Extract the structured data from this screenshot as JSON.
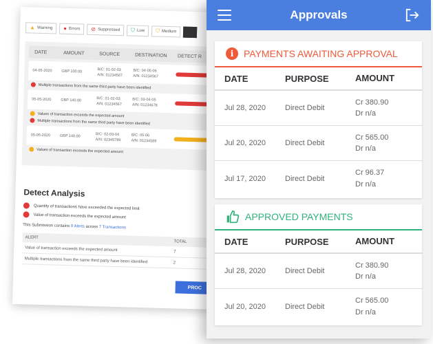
{
  "back": {
    "legend": [
      {
        "label": "Warning",
        "icon": "warning-icon",
        "color": "#f2b01e"
      },
      {
        "label": "Errors",
        "icon": "error-icon",
        "color": "#e03a3a"
      },
      {
        "label": "Suppressed",
        "icon": "suppressed-icon",
        "color": "#e03a3a"
      },
      {
        "label": "Low",
        "icon": "shield-low-icon",
        "color": "#2fb37a"
      },
      {
        "label": "Medium",
        "icon": "shield-medium-icon",
        "color": "#f2b01e"
      }
    ],
    "columns": [
      "DATE",
      "AMOUNT",
      "SOURCE",
      "DESTINATION",
      "DETECT R"
    ],
    "rows": [
      {
        "date": "04-05-2020",
        "amount": "GBP 100.00",
        "source": [
          "B/C: 01-02-03",
          "A/N: 01234567"
        ],
        "destination": [
          "B/C: 04-05-06",
          "A/N: 01234567"
        ],
        "bar": "#e03a3a",
        "notes": [
          "Multiple transactions from the same third party have been identified"
        ]
      },
      {
        "date": "05-05-2020",
        "amount": "GBP 140.00",
        "source": [
          "B/C: 01-02-03",
          "A/N: 01234567"
        ],
        "destination": [
          "B/C: 03-04-05",
          "A/N: 01234678"
        ],
        "bar": "#e03a3a",
        "notes": [
          "Values of transaction exceeds the expected amount",
          "Multiple transactions from the same third party have been identified"
        ]
      },
      {
        "date": "05-05-2020",
        "amount": "GBP 140.00",
        "source": [
          "B/C: 02-03-04",
          "A/N: 02345789"
        ],
        "destination": [
          "B/C: 05-06",
          "A/N: 01234589"
        ],
        "bar": "#f2b01e",
        "notes": [
          "Values of transaction exceeds the expected amount"
        ]
      }
    ],
    "analysis": {
      "title": "Detect Analysis",
      "items": [
        "Quantity of transactions have exceeded the expected limit",
        "Value of transaction exceeds the expected amount"
      ],
      "summary_prefix": "This Submission contains ",
      "summary_alerts": "9 Alerts",
      "summary_mid": " across ",
      "summary_tx": "7 Transactions",
      "table_head": [
        "ALERT",
        "TOTAL"
      ],
      "table_rows": [
        {
          "alert": "Value of transaction exceeds the expected amount",
          "total": "7"
        },
        {
          "alert": "Multiple transactions from the same third party have been identified",
          "total": "2"
        }
      ],
      "button": "PROC"
    }
  },
  "mobile": {
    "title": "Approvals",
    "awaiting": {
      "title": "PAYMENTS AWAITING APPROVAL",
      "columns": {
        "date": "DATE",
        "purpose": "PURPOSE",
        "amount": "AMOUNT"
      },
      "rows": [
        {
          "date": "Jul 28, 2020",
          "purpose": "Direct Debit",
          "cr": "Cr 380.90",
          "dr": "Dr n/a"
        },
        {
          "date": "Jul 20, 2020",
          "purpose": "Direct Debit",
          "cr": "Cr 565.00",
          "dr": "Dr n/a"
        },
        {
          "date": "Jul 17, 2020",
          "purpose": "Direct Debit",
          "cr": "Cr 96.37",
          "dr": "Dr n/a"
        }
      ]
    },
    "approved": {
      "title": "APPROVED PAYMENTS",
      "columns": {
        "date": "DATE",
        "purpose": "PURPOSE",
        "amount": "AMOUNT"
      },
      "rows": [
        {
          "date": "Jul 28, 2020",
          "purpose": "Direct Debit",
          "cr": "Cr 380.90",
          "dr": "Dr n/a"
        },
        {
          "date": "Jul 20, 2020",
          "purpose": "Direct Debit",
          "cr": "Cr 565.00",
          "dr": "Dr n/a"
        }
      ]
    },
    "colors": {
      "header": "#4a7fe0",
      "awaiting": "#ee5a3a",
      "approved": "#2fb37a"
    }
  }
}
